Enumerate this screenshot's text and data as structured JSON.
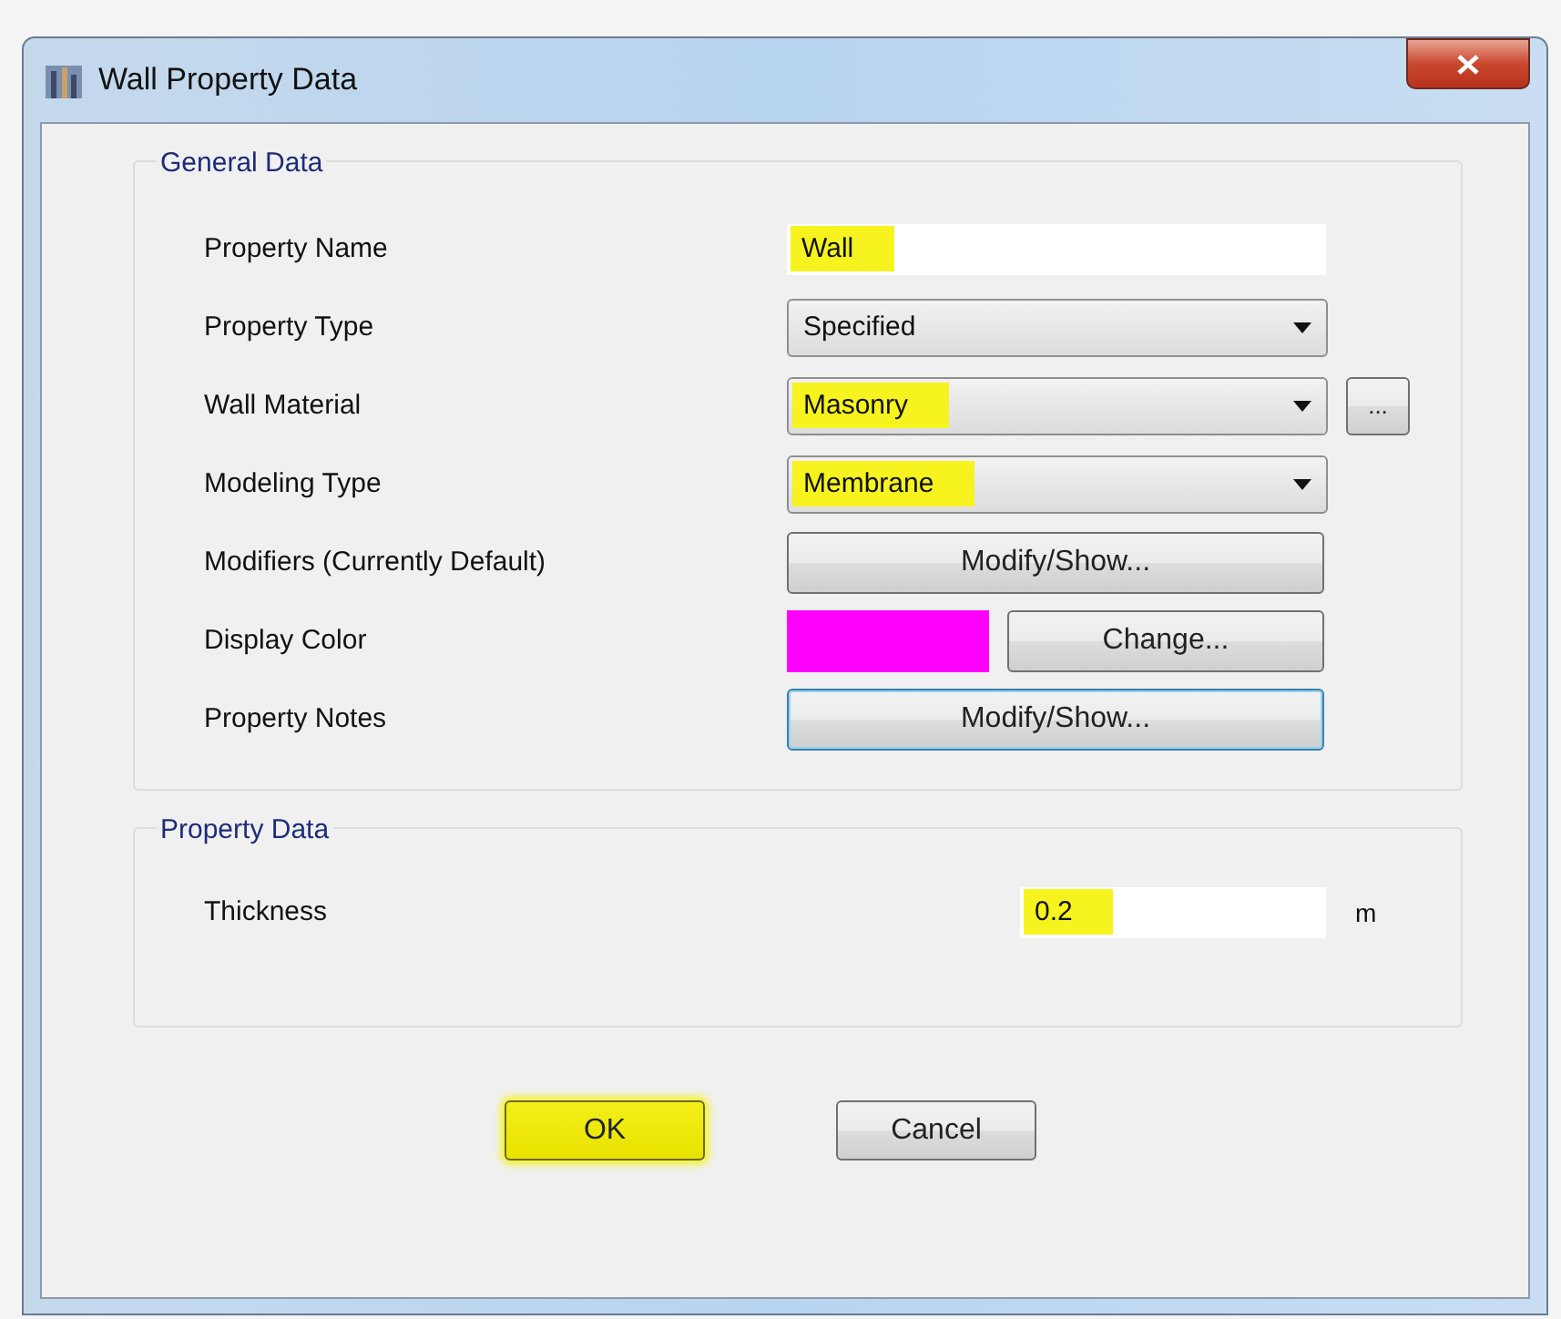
{
  "window": {
    "title": "Wall Property Data"
  },
  "general_data": {
    "title": "General Data",
    "rows": [
      {
        "label": "Property Name",
        "kind": "text",
        "value": "Wall",
        "highlighted": true
      },
      {
        "label": "Property Type",
        "kind": "dropdown",
        "value": "Specified",
        "highlighted": false
      },
      {
        "label": "Wall Material",
        "kind": "dropdown",
        "value": "Masonry",
        "highlighted": true,
        "extra_button": "..."
      },
      {
        "label": "Modeling Type",
        "kind": "dropdown",
        "value": "Membrane",
        "highlighted": true
      },
      {
        "label": "Modifiers (Currently Default)",
        "kind": "button",
        "value": "Modify/Show...",
        "focused": false
      },
      {
        "label": "Display Color",
        "kind": "color",
        "color": "#ff00ff",
        "value": "Change..."
      },
      {
        "label": "Property Notes",
        "kind": "button",
        "value": "Modify/Show...",
        "focused": true
      }
    ]
  },
  "property_data": {
    "title": "Property Data",
    "rows": [
      {
        "label": "Thickness",
        "kind": "text",
        "value": "0.2",
        "highlighted": true,
        "unit": "m"
      }
    ]
  },
  "buttons": [
    {
      "label": "OK",
      "highlighted": true
    },
    {
      "label": "Cancel",
      "highlighted": false
    }
  ]
}
